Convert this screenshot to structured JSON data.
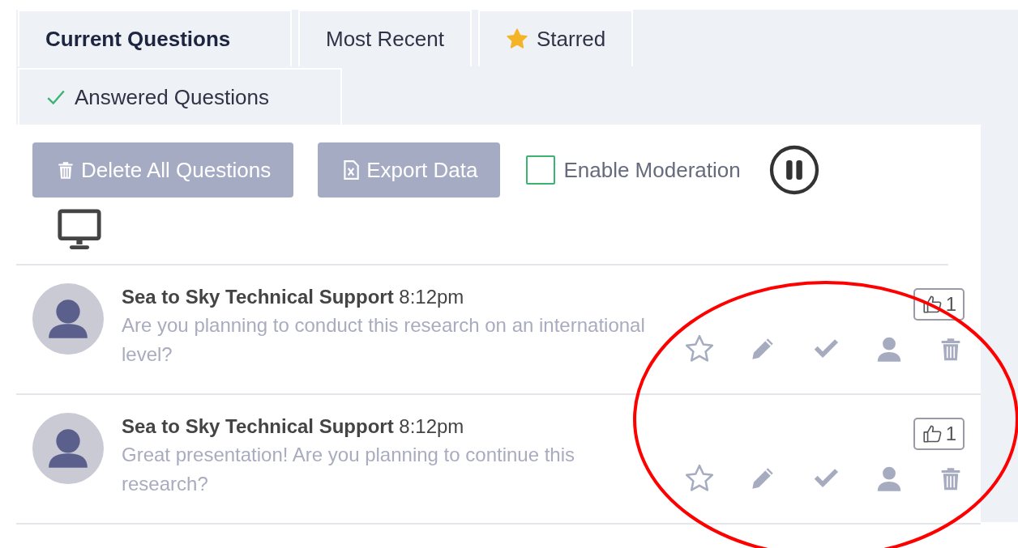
{
  "tabs": [
    {
      "label": "Current Questions",
      "selected": true
    },
    {
      "label": "Most Recent",
      "selected": false
    },
    {
      "label": "Starred",
      "selected": false,
      "kind": "star"
    },
    {
      "label": "Answered Questions",
      "selected": false,
      "kind": "check"
    }
  ],
  "toolbar": {
    "buttons": [
      {
        "label": "Delete All Questions",
        "kind": "trash"
      },
      {
        "label": "Export Data",
        "kind": "file"
      }
    ],
    "moderation": {
      "label": "Enable Moderation",
      "checked": false
    }
  },
  "questions": [
    {
      "author": "Sea to Sky Technical Support",
      "time": "8:12pm",
      "text": "Are you planning to conduct this research on an international level?",
      "votes": "1",
      "starred": false
    },
    {
      "author": "Sea to Sky Technical Support",
      "time": "8:12pm",
      "text": "Great presentation! Are you planning to continue this research?",
      "votes": "1",
      "starred": false
    }
  ]
}
